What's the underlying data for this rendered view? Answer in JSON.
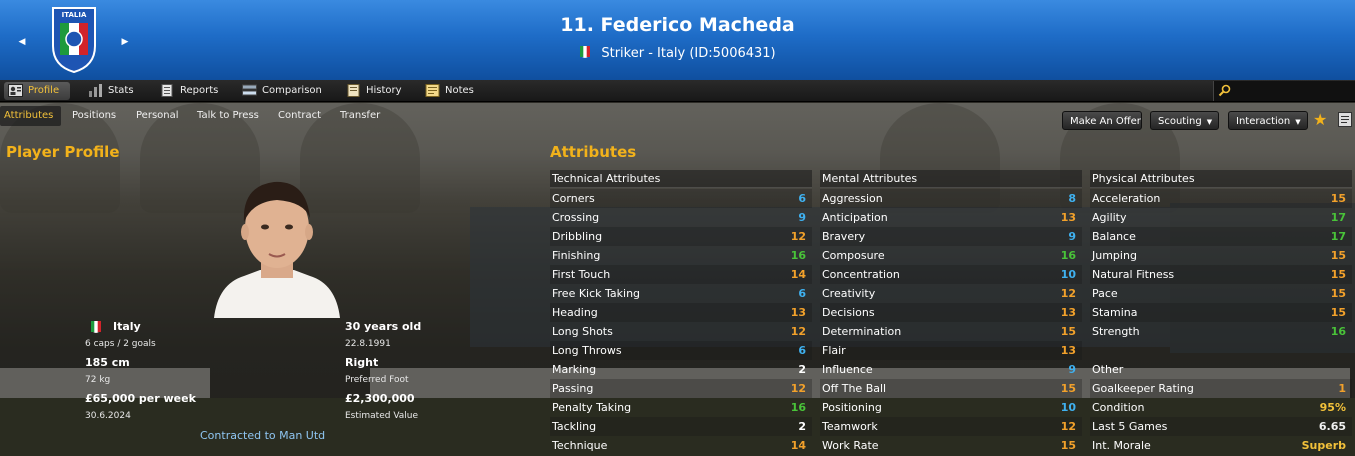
{
  "header": {
    "crest_text": "ITALIA",
    "title": "11. Federico Macheda",
    "subtitle": "Striker - Italy (ID:5006431)"
  },
  "tabs": [
    {
      "label": "Profile",
      "icon": "profile-icon"
    },
    {
      "label": "Stats",
      "icon": "stats-icon"
    },
    {
      "label": "Reports",
      "icon": "reports-icon"
    },
    {
      "label": "Comparison",
      "icon": "comparison-icon"
    },
    {
      "label": "History",
      "icon": "history-icon"
    },
    {
      "label": "Notes",
      "icon": "notes-icon"
    }
  ],
  "subtabs": [
    "Attributes",
    "Positions",
    "Personal",
    "Talk to Press",
    "Contract",
    "Transfer"
  ],
  "actions": {
    "offer": "Make An Offer",
    "scouting": "Scouting",
    "interaction": "Interaction"
  },
  "profile": {
    "title": "Player Profile",
    "nationality": "Italy",
    "caps": "6 caps / 2 goals",
    "age": "30 years old",
    "dob": "22.8.1991",
    "height": "185 cm",
    "weight": "72 kg",
    "foot": "Right",
    "foot_label": "Preferred Foot",
    "wage": "£65,000 per week",
    "contract_end": "30.6.2024",
    "value": "£2,300,000",
    "value_label": "Estimated Value",
    "contract_note": "Contracted to Man Utd"
  },
  "attributes": {
    "title": "Attributes",
    "technical": {
      "header": "Technical Attributes",
      "rows": [
        {
          "name": "Corners",
          "value": "6"
        },
        {
          "name": "Crossing",
          "value": "9"
        },
        {
          "name": "Dribbling",
          "value": "12"
        },
        {
          "name": "Finishing",
          "value": "16"
        },
        {
          "name": "First Touch",
          "value": "14"
        },
        {
          "name": "Free Kick Taking",
          "value": "6"
        },
        {
          "name": "Heading",
          "value": "13"
        },
        {
          "name": "Long Shots",
          "value": "12"
        },
        {
          "name": "Long Throws",
          "value": "6"
        },
        {
          "name": "Marking",
          "value": "2"
        },
        {
          "name": "Passing",
          "value": "12"
        },
        {
          "name": "Penalty Taking",
          "value": "16"
        },
        {
          "name": "Tackling",
          "value": "2"
        },
        {
          "name": "Technique",
          "value": "14"
        }
      ]
    },
    "mental": {
      "header": "Mental Attributes",
      "rows": [
        {
          "name": "Aggression",
          "value": "8"
        },
        {
          "name": "Anticipation",
          "value": "13"
        },
        {
          "name": "Bravery",
          "value": "9"
        },
        {
          "name": "Composure",
          "value": "16"
        },
        {
          "name": "Concentration",
          "value": "10"
        },
        {
          "name": "Creativity",
          "value": "12"
        },
        {
          "name": "Decisions",
          "value": "13"
        },
        {
          "name": "Determination",
          "value": "15"
        },
        {
          "name": "Flair",
          "value": "13"
        },
        {
          "name": "Influence",
          "value": "9"
        },
        {
          "name": "Off The Ball",
          "value": "15"
        },
        {
          "name": "Positioning",
          "value": "10"
        },
        {
          "name": "Teamwork",
          "value": "12"
        },
        {
          "name": "Work Rate",
          "value": "15"
        }
      ]
    },
    "physical": {
      "header": "Physical Attributes",
      "rows": [
        {
          "name": "Acceleration",
          "value": "15"
        },
        {
          "name": "Agility",
          "value": "17"
        },
        {
          "name": "Balance",
          "value": "17"
        },
        {
          "name": "Jumping",
          "value": "15"
        },
        {
          "name": "Natural Fitness",
          "value": "15"
        },
        {
          "name": "Pace",
          "value": "15"
        },
        {
          "name": "Stamina",
          "value": "15"
        },
        {
          "name": "Strength",
          "value": "16"
        }
      ]
    },
    "other": {
      "header": "Other",
      "rows": [
        {
          "name": "Goalkeeper Rating",
          "value": "1"
        },
        {
          "name": "Condition",
          "value": "95%"
        },
        {
          "name": "Last 5 Games",
          "value": "6.65"
        },
        {
          "name": "Int. Morale",
          "value": "Superb"
        }
      ]
    }
  },
  "colors": {
    "blue_low": "#3fb1f0",
    "orange_mid": "#f2a12b",
    "green_high": "#49c339",
    "white_min": "#ffffff",
    "accent": "#f2b21b"
  }
}
